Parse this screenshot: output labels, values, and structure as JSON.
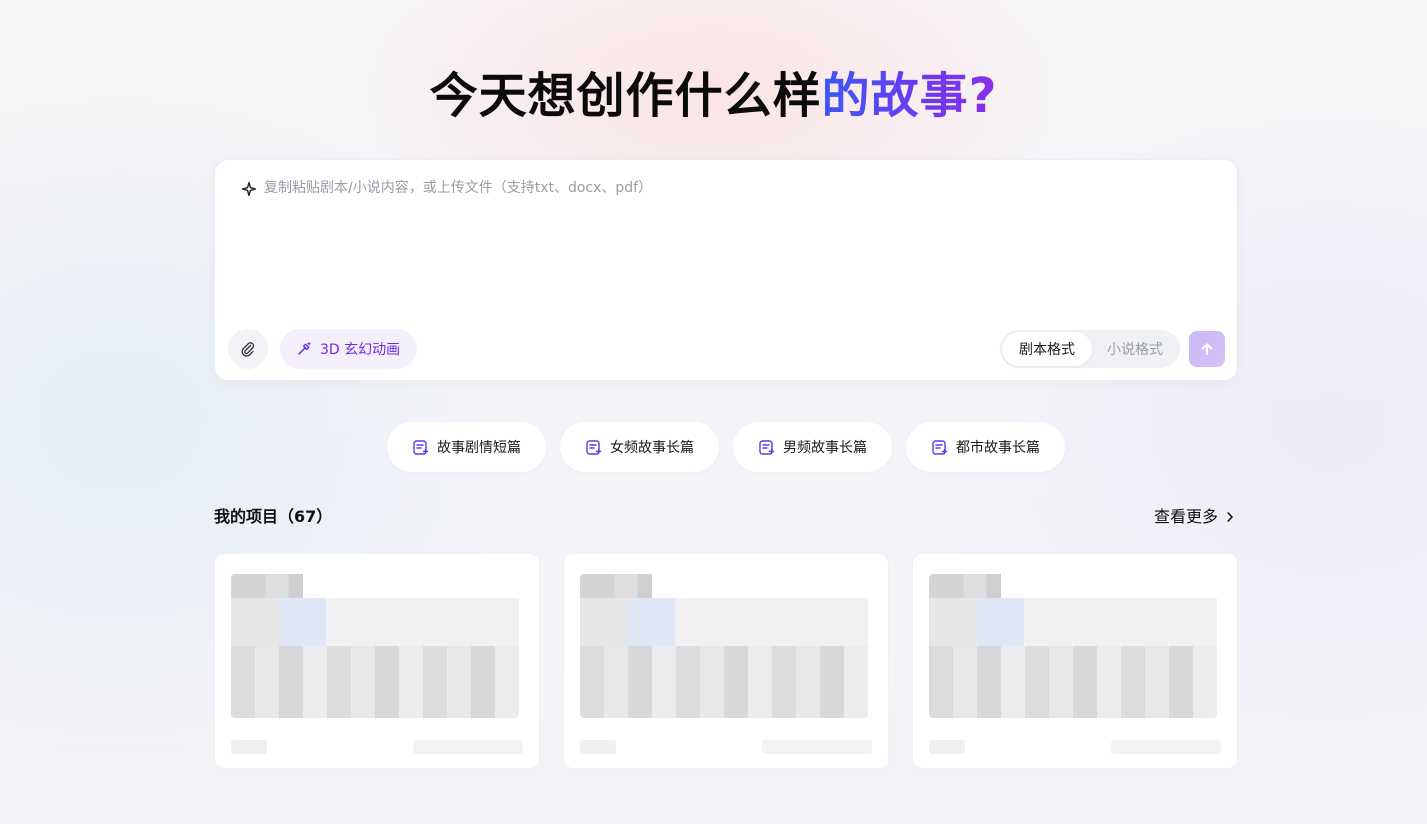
{
  "headline": {
    "plain": "今天想创作什么样",
    "highlight": "的故事?"
  },
  "editor": {
    "placeholder": "复制粘贴剧本/小说内容，或上传文件（支持txt、docx、pdf）",
    "style_button_label": "3D 玄幻动画",
    "format_options": [
      "剧本格式",
      "小说格式"
    ],
    "selected_format": "剧本格式"
  },
  "chips": [
    {
      "label": "故事剧情短篇",
      "icon": "doc-edit-icon"
    },
    {
      "label": "女频故事长篇",
      "icon": "doc-edit-icon"
    },
    {
      "label": "男频故事长篇",
      "icon": "doc-edit-icon"
    },
    {
      "label": "都市故事长篇",
      "icon": "doc-edit-icon"
    }
  ],
  "projects": {
    "title": "我的项目（67）",
    "see_more": "查看更多",
    "cards": [
      {
        "thumbnail": "blurred"
      },
      {
        "thumbnail": "blurred"
      },
      {
        "thumbnail": "blurred"
      }
    ]
  },
  "colors": {
    "accent_start": "#3b57f5",
    "accent_end": "#8a2ee8",
    "style_text": "#6d2be0",
    "send_button": "#c9b8f6"
  }
}
